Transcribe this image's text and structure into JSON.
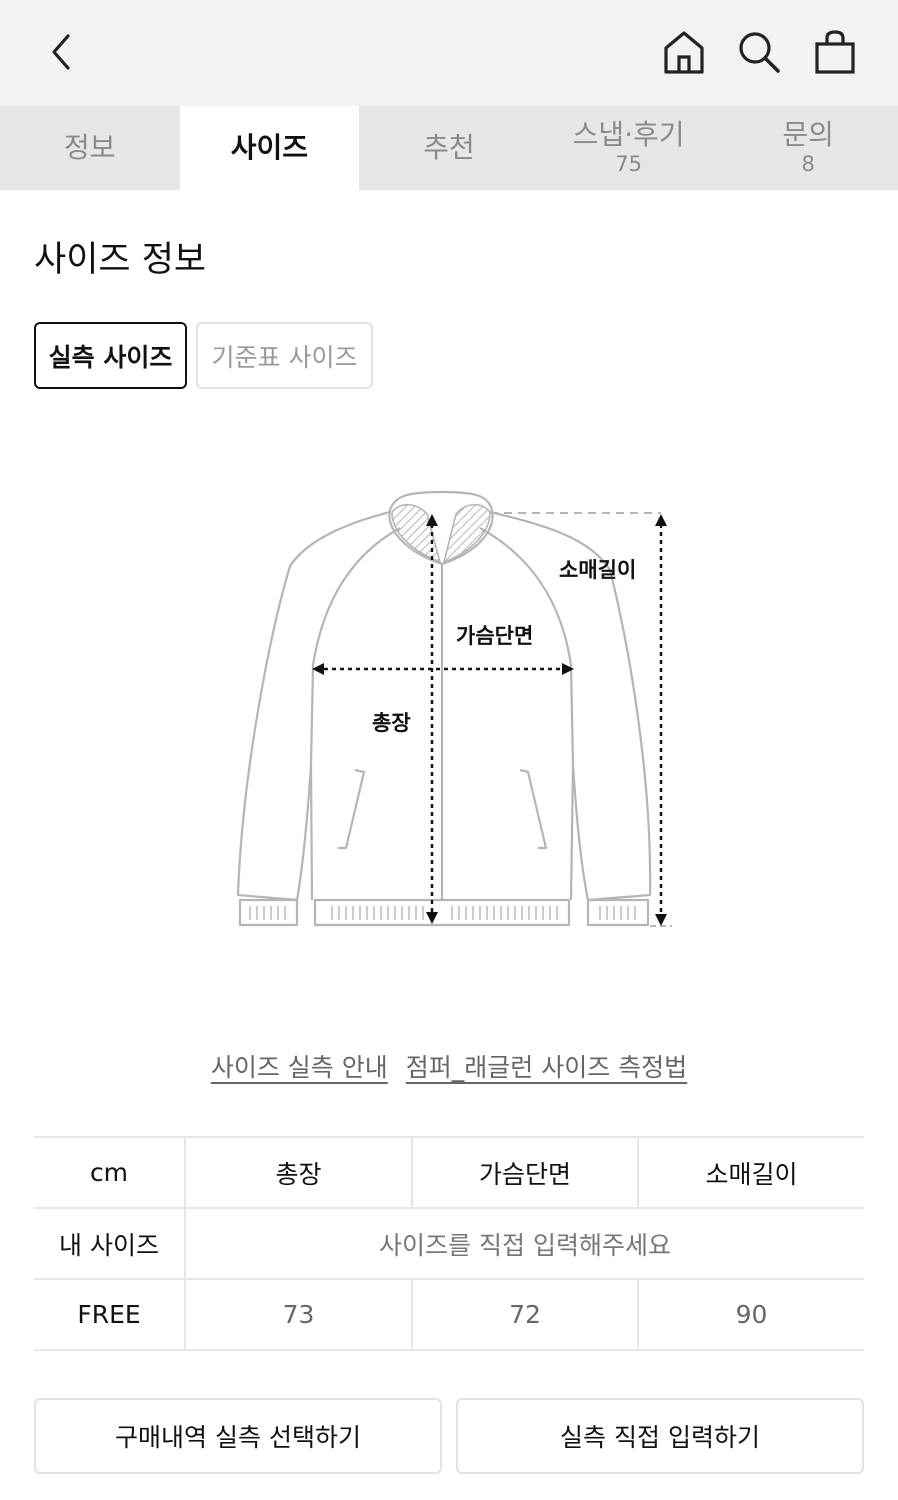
{
  "header": {
    "back_icon": "chevron-left-icon",
    "home_icon": "home-icon",
    "search_icon": "search-icon",
    "bag_icon": "shopping-bag-icon"
  },
  "tabs": [
    {
      "label": "정보",
      "count": ""
    },
    {
      "label": "사이즈",
      "count": ""
    },
    {
      "label": "추천",
      "count": ""
    },
    {
      "label": "스냅·후기",
      "count": "75"
    },
    {
      "label": "문의",
      "count": "8"
    }
  ],
  "active_tab": "사이즈",
  "section_title": "사이즈 정보",
  "size_toggle": {
    "measured": "실측 사이즈",
    "standard": "기준표 사이즈"
  },
  "diagram": {
    "label_length": "총장",
    "label_chest": "가슴단면",
    "label_sleeve": "소매길이"
  },
  "guide_links": {
    "measure_guide": "사이즈 실측 안내",
    "method": "점퍼_래글런 사이즈 측정법"
  },
  "size_table": {
    "headers": [
      "cm",
      "총장",
      "가슴단면",
      "소매길이"
    ],
    "my_size_label": "내 사이즈",
    "my_size_placeholder": "사이즈를 직접 입력해주세요",
    "rows": [
      {
        "size": "FREE",
        "values": [
          "73",
          "72",
          "90"
        ]
      }
    ]
  },
  "buttons": {
    "history": "구매내역 실측 선택하기",
    "direct": "실측 직접 입력하기"
  },
  "colors": {
    "topbar_bg": "#f2f2f2",
    "tab_bg": "#e6e6e6",
    "active_tab_bg": "#ffffff",
    "border": "#e6e6e6"
  }
}
